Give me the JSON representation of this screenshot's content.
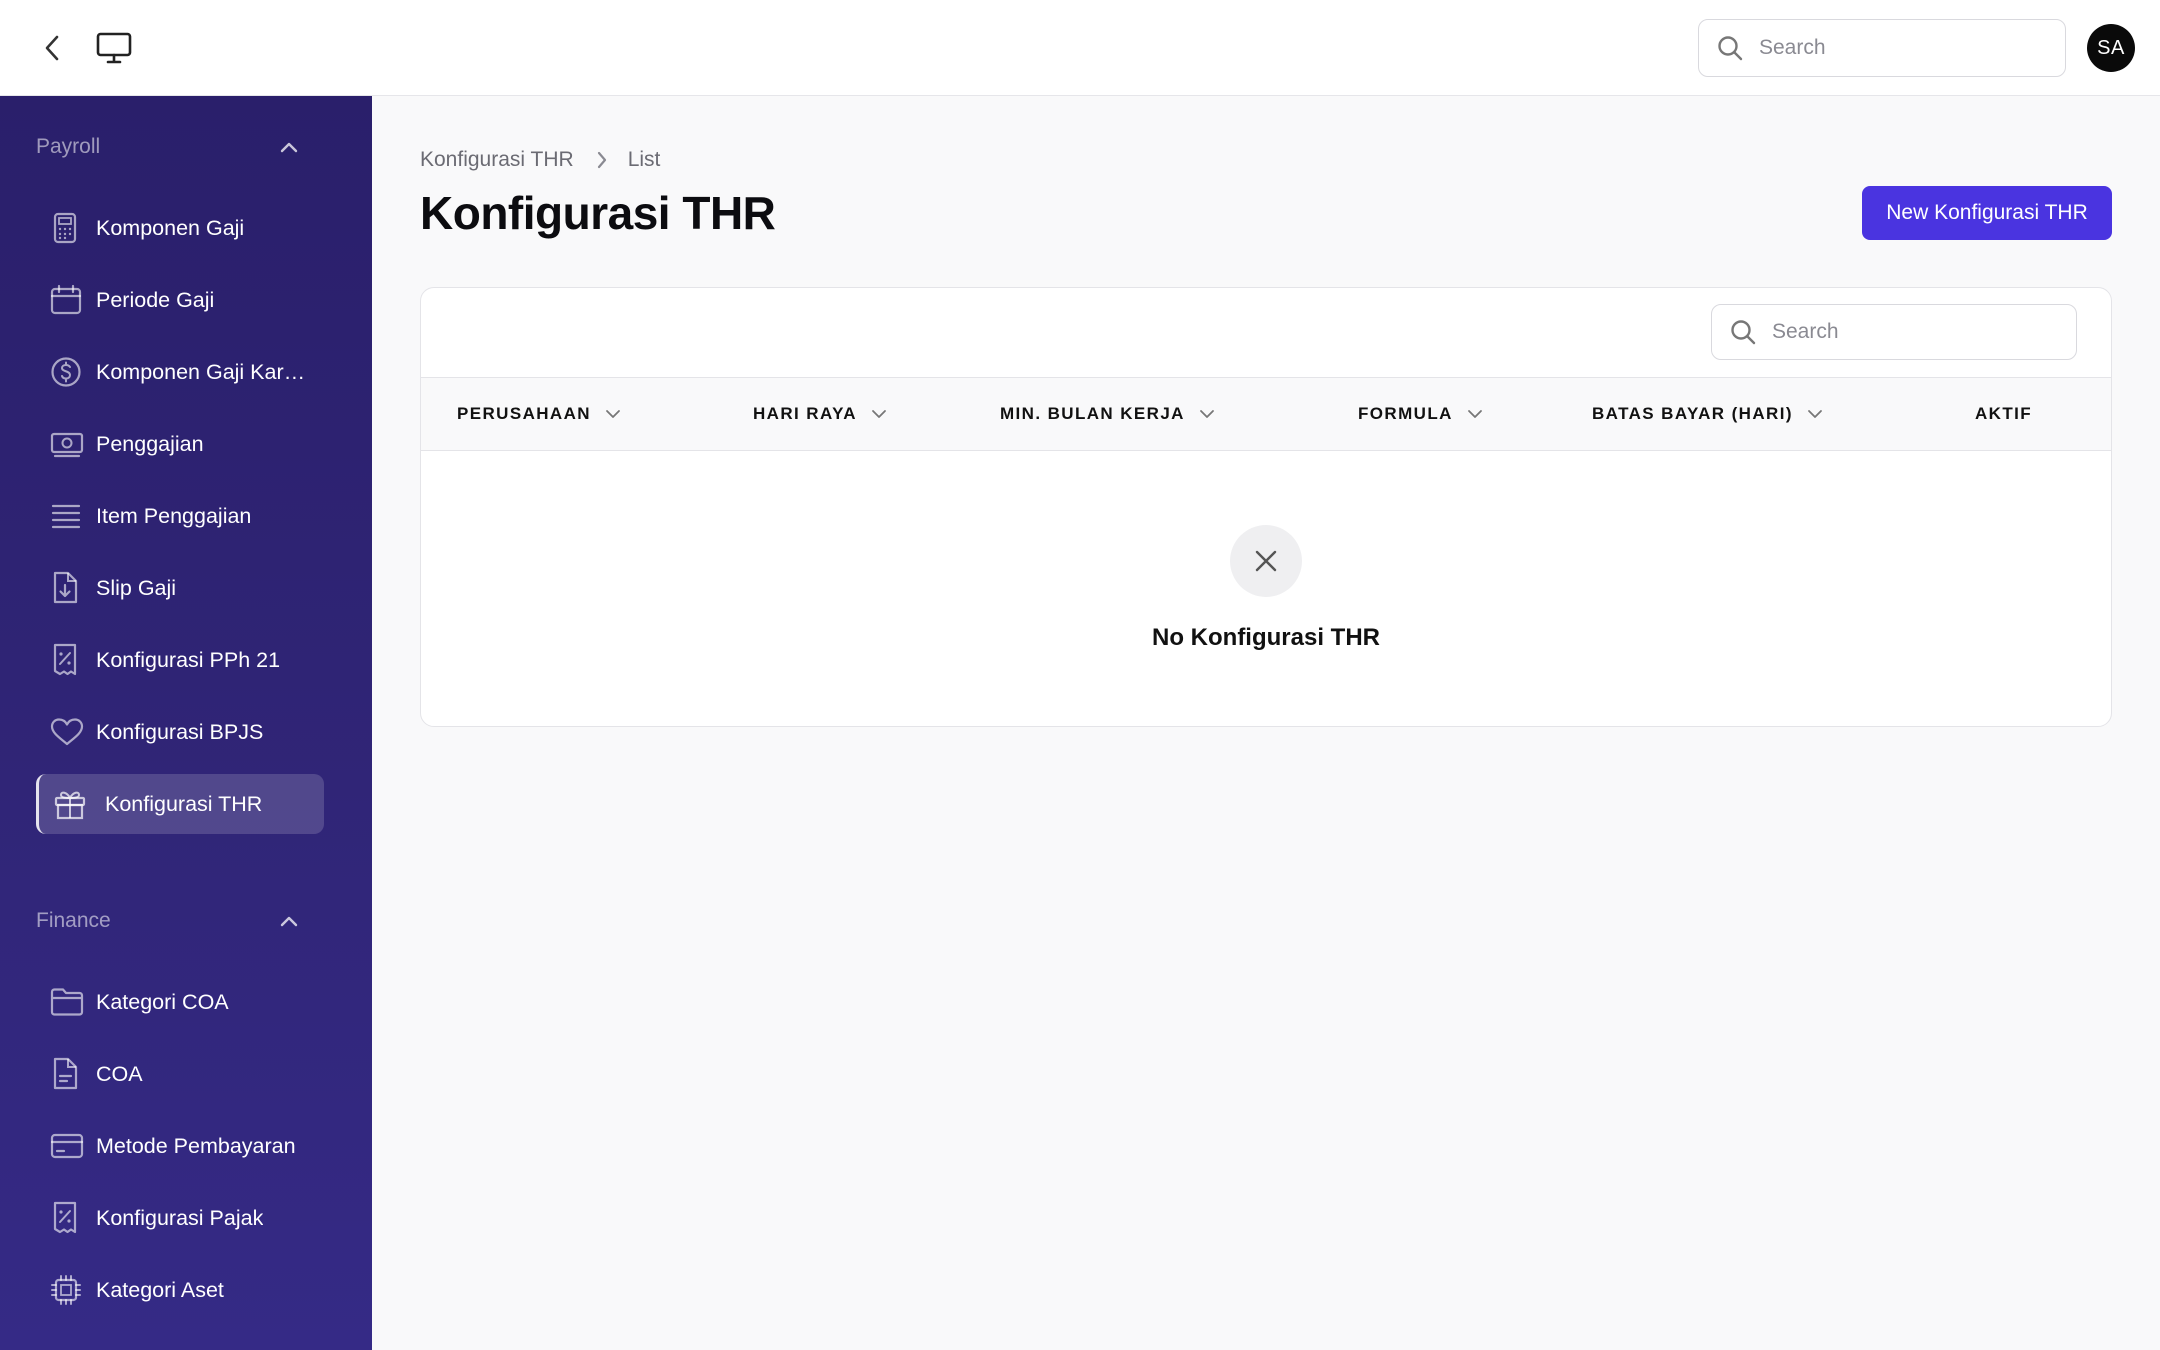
{
  "topbar": {
    "search_placeholder": "Search",
    "avatar_initials": "SA"
  },
  "sidebar": {
    "groups": [
      {
        "label": "Payroll",
        "items": [
          {
            "label": "Komponen Gaji",
            "icon": "calculator-icon"
          },
          {
            "label": "Periode Gaji",
            "icon": "calendar-icon"
          },
          {
            "label": "Komponen Gaji Karyawan",
            "icon": "dollar-circle-icon"
          },
          {
            "label": "Penggajian",
            "icon": "cash-icon"
          },
          {
            "label": "Item Penggajian",
            "icon": "list-icon"
          },
          {
            "label": "Slip Gaji",
            "icon": "document-download-icon"
          },
          {
            "label": "Konfigurasi PPh 21",
            "icon": "receipt-percent-icon"
          },
          {
            "label": "Konfigurasi BPJS",
            "icon": "heart-icon"
          },
          {
            "label": "Konfigurasi THR",
            "icon": "gift-icon",
            "active": true
          }
        ]
      },
      {
        "label": "Finance",
        "items": [
          {
            "label": "Kategori COA",
            "icon": "folder-icon"
          },
          {
            "label": "COA",
            "icon": "document-text-icon"
          },
          {
            "label": "Metode Pembayaran",
            "icon": "credit-card-icon"
          },
          {
            "label": "Konfigurasi Pajak",
            "icon": "receipt-percent-icon"
          },
          {
            "label": "Kategori Aset",
            "icon": "cpu-chip-icon"
          }
        ]
      }
    ]
  },
  "main": {
    "breadcrumb": [
      "Konfigurasi THR",
      "List"
    ],
    "title": "Konfigurasi THR",
    "new_button_label": "New Konfigurasi THR",
    "table": {
      "search_placeholder": "Search",
      "columns": [
        {
          "label": "PERUSAHAAN",
          "sortable": true
        },
        {
          "label": "HARI RAYA",
          "sortable": true
        },
        {
          "label": "MIN. BULAN KERJA",
          "sortable": true
        },
        {
          "label": "FORMULA",
          "sortable": true
        },
        {
          "label": "BATAS BAYAR (HARI)",
          "sortable": true
        },
        {
          "label": "AKTIF",
          "sortable": false
        }
      ],
      "empty_text": "No Konfigurasi THR"
    }
  },
  "colors": {
    "accent": "#4a34e0",
    "sidebar_top": "#2a1f6b",
    "sidebar_bottom": "#352a86"
  }
}
